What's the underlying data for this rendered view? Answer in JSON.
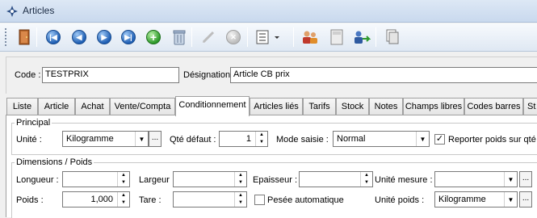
{
  "window": {
    "title": "Articles"
  },
  "toolbar": {
    "icons": [
      "exit-door-icon",
      "first-record-icon",
      "previous-record-icon",
      "next-record-icon",
      "last-record-icon",
      "add-icon",
      "delete-icon",
      "edit-icon",
      "cancel-icon",
      "list-dropdown-icon",
      "people-icon",
      "document-icon",
      "transfer-icon",
      "print-icon"
    ]
  },
  "header": {
    "code_label": "Code :",
    "code_value": "TESTPRIX",
    "designation_label": "Désignation :",
    "designation_value": "Article CB prix"
  },
  "tabs": [
    {
      "label": "Liste"
    },
    {
      "label": "Article"
    },
    {
      "label": "Achat"
    },
    {
      "label": "Vente/Compta"
    },
    {
      "label": "Conditionnement"
    },
    {
      "label": "Articles liés"
    },
    {
      "label": "Tarifs"
    },
    {
      "label": "Stock"
    },
    {
      "label": "Notes"
    },
    {
      "label": "Champs libres"
    },
    {
      "label": "Codes barres"
    },
    {
      "label": "St"
    }
  ],
  "active_tab": "Conditionnement",
  "principal": {
    "title": "Principal",
    "unite_label": "Unité :",
    "unite_value": "Kilogramme",
    "qte_label": "Qté défaut :",
    "qte_value": "1",
    "mode_label": "Mode saisie :",
    "mode_value": "Normal",
    "reporter_label": "Reporter poids sur qté",
    "reporter_checked": true
  },
  "dimensions": {
    "title": "Dimensions / Poids",
    "longueur_label": "Longueur :",
    "longueur_value": "",
    "largeur_label": "Largeur :",
    "largeur_value": "",
    "epaisseur_label": "Epaisseur :",
    "epaisseur_value": "",
    "unite_mesure_label": "Unité mesure :",
    "unite_mesure_value": "",
    "poids_label": "Poids :",
    "poids_value": "1,000",
    "tare_label": "Tare :",
    "tare_value": "",
    "pesee_label": "Pesée automatique",
    "pesee_checked": false,
    "unite_poids_label": "Unité poids :",
    "unite_poids_value": "Kilogramme"
  },
  "ellipsis": "...",
  "checkmark": "✓"
}
